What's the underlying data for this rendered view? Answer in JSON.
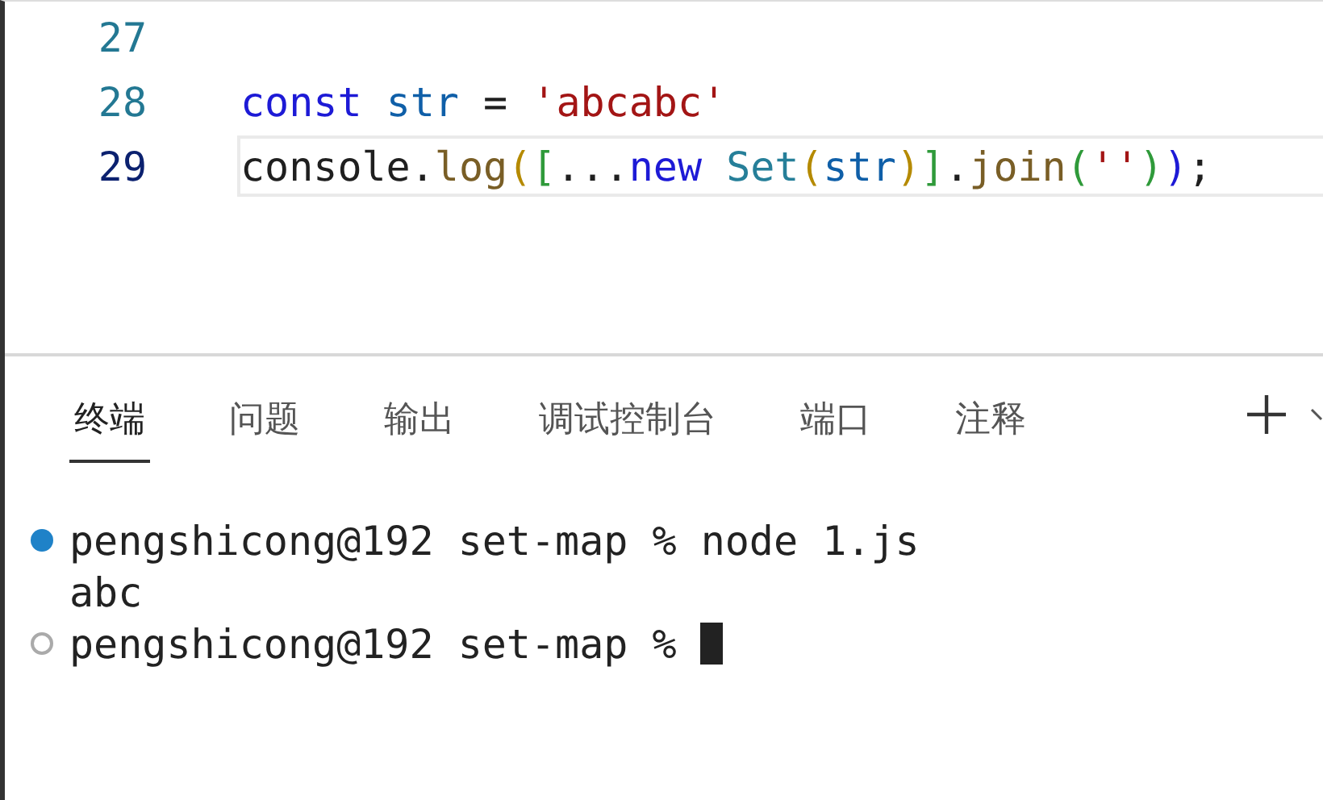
{
  "editor": {
    "lines": [
      {
        "number": "27",
        "current": false
      },
      {
        "number": "28",
        "current": false,
        "tokens": [
          {
            "kind": "keyword",
            "text": "const"
          },
          {
            "kind": "variable",
            "text": " str"
          },
          {
            "kind": "plain",
            "text": " = "
          },
          {
            "kind": "string",
            "text": "'abcabc'"
          }
        ]
      },
      {
        "number": "29",
        "current": true,
        "tokens": [
          {
            "kind": "plain",
            "text": "console."
          },
          {
            "kind": "function",
            "text": "log"
          },
          {
            "kind": "bracket1",
            "text": "("
          },
          {
            "kind": "bracket2",
            "text": "["
          },
          {
            "kind": "plain",
            "text": "..."
          },
          {
            "kind": "keyword",
            "text": "new"
          },
          {
            "kind": "class",
            "text": " Set"
          },
          {
            "kind": "bracket1",
            "text": "("
          },
          {
            "kind": "variable",
            "text": "str"
          },
          {
            "kind": "bracket1",
            "text": ")"
          },
          {
            "kind": "bracket2",
            "text": "]"
          },
          {
            "kind": "plain",
            "text": "."
          },
          {
            "kind": "function",
            "text": "join"
          },
          {
            "kind": "bracket2",
            "text": "("
          },
          {
            "kind": "string",
            "text": "''"
          },
          {
            "kind": "bracket2",
            "text": ")"
          },
          {
            "kind": "bracket3",
            "text": ")"
          },
          {
            "kind": "plain",
            "text": ";"
          }
        ]
      }
    ]
  },
  "panel": {
    "tabs": [
      {
        "label": "终端",
        "selected": true
      },
      {
        "label": "问题",
        "selected": false
      },
      {
        "label": "输出",
        "selected": false
      },
      {
        "label": "调试控制台",
        "selected": false
      },
      {
        "label": "端口",
        "selected": false
      },
      {
        "label": "注释",
        "selected": false
      }
    ]
  },
  "terminal": {
    "lines": [
      {
        "kind": "command",
        "done": true,
        "text": "pengshicong@192 set-map % node 1.js"
      },
      {
        "kind": "output",
        "text": "abc"
      },
      {
        "kind": "command",
        "done": false,
        "text": "pengshicong@192 set-map %",
        "cursor": true
      }
    ]
  }
}
